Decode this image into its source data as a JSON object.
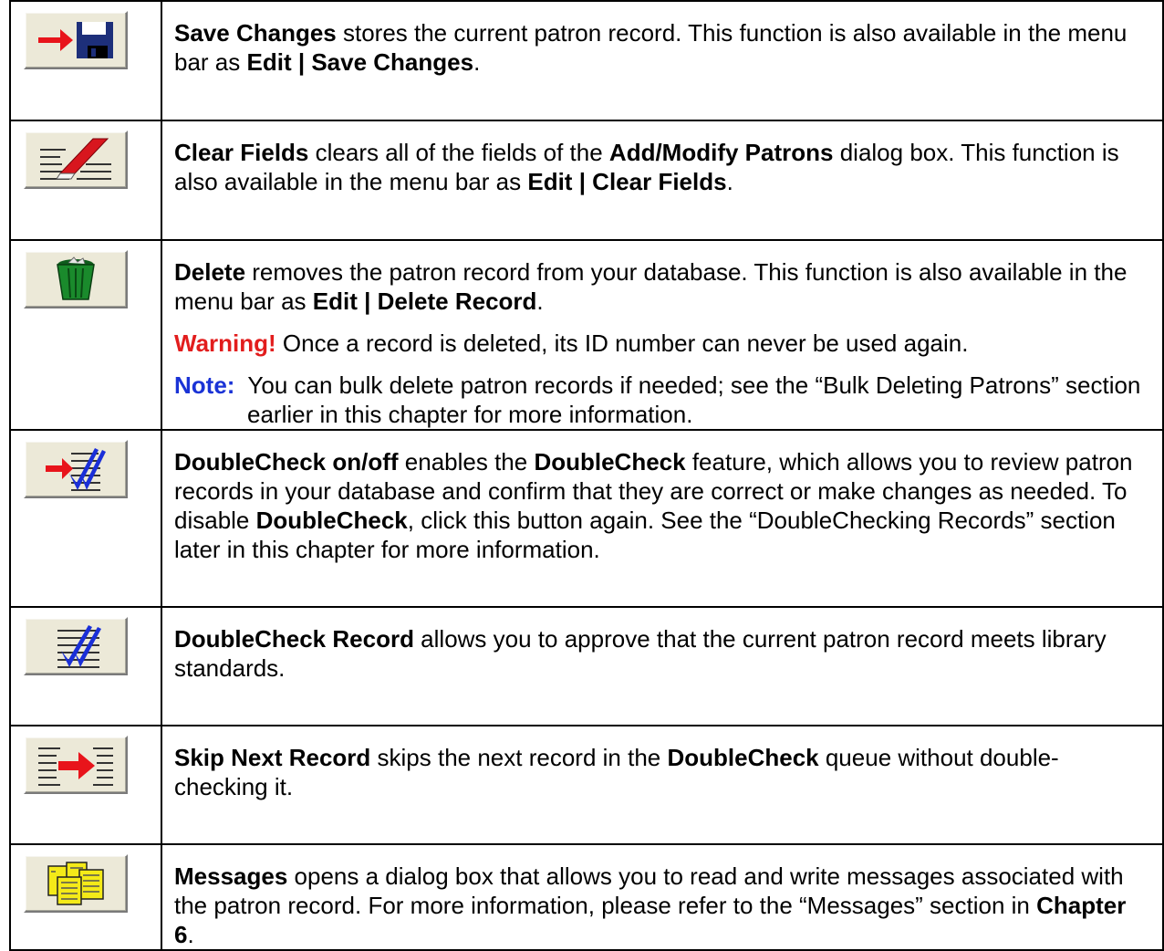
{
  "rows": [
    {
      "icon": "save-changes-icon",
      "term": "Save Changes",
      "text1": " stores the current patron record. This function is also available in the menu bar as ",
      "menu": "Edit | Save Changes",
      "end": "."
    },
    {
      "icon": "clear-fields-icon",
      "term": "Clear Fields",
      "text1": " clears all of the fields of the ",
      "dialog": "Add/Modify Patrons",
      "text2": " dialog box. This function is also available in the menu bar as ",
      "menu": "Edit | Clear Fields",
      "end": "."
    },
    {
      "icon": "delete-trash-icon",
      "term": "Delete",
      "text1": " removes the patron record from your database. This function is also available in the menu bar as ",
      "menu": "Edit | Delete Record",
      "end": ".",
      "warning_label": "Warning!",
      "warning_text": " Once a record is deleted, its ID number can never be used again.",
      "note_label": "Note:",
      "note_text": "  You can bulk delete patron records if needed; see the “Bulk Deleting Patrons” section earlier in this chapter for more information."
    },
    {
      "icon": "doublecheck-toggle-icon",
      "term": "DoubleCheck on/off",
      "text1": " enables the ",
      "feature": "DoubleCheck",
      "text2": " feature, which allows you to review patron records in your database and confirm that they are correct or make changes as needed. To disable ",
      "feature2": "DoubleCheck",
      "text3": ", click this button again. See the “DoubleChecking Records” section later in this chapter for more information."
    },
    {
      "icon": "doublecheck-record-icon",
      "term": "DoubleCheck Record",
      "text1": " allows you to approve that the current patron record meets library standards."
    },
    {
      "icon": "skip-next-record-icon",
      "term": "Skip Next Record",
      "text1": " skips the next record in the ",
      "feature": "DoubleCheck",
      "text2": " queue without double-checking it."
    },
    {
      "icon": "messages-icon",
      "term": "Messages",
      "text1": " opens a dialog box that allows you to read and write messages associated with the patron record. For more information, please refer to the “Messages” section in ",
      "chapter": "Chapter 6",
      "end": "."
    }
  ]
}
